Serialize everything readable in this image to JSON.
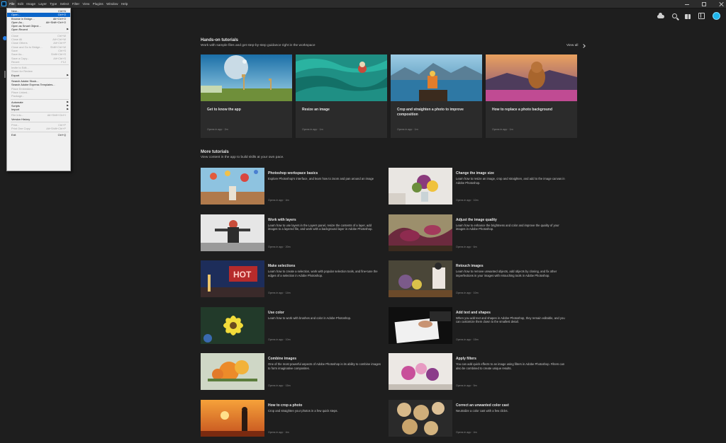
{
  "menubar": {
    "items": [
      "File",
      "Edit",
      "Image",
      "Layer",
      "Type",
      "Select",
      "Filter",
      "View",
      "Plugins",
      "Window",
      "Help"
    ]
  },
  "file_menu": {
    "items": [
      {
        "label": "New...",
        "shortcut": "Ctrl+N",
        "state": "normal"
      },
      {
        "label": "Open...",
        "shortcut": "Ctrl+O",
        "state": "highlight"
      },
      {
        "label": "Browse in Bridge...",
        "shortcut": "Alt+Ctrl+O",
        "state": "normal"
      },
      {
        "label": "Open As...",
        "shortcut": "Alt+Shift+Ctrl+O",
        "state": "normal"
      },
      {
        "label": "Open as Smart Object...",
        "shortcut": "",
        "state": "normal"
      },
      {
        "label": "Open Recent",
        "shortcut": "",
        "state": "normal",
        "submenu": true,
        "sep_after": true
      },
      {
        "label": "Close",
        "shortcut": "Ctrl+W",
        "state": "disabled"
      },
      {
        "label": "Close All",
        "shortcut": "Alt+Ctrl+W",
        "state": "disabled"
      },
      {
        "label": "Close Others",
        "shortcut": "Alt+Ctrl+P",
        "state": "disabled"
      },
      {
        "label": "Close and Go to Bridge...",
        "shortcut": "Shift+Ctrl+W",
        "state": "disabled"
      },
      {
        "label": "Save",
        "shortcut": "Ctrl+S",
        "state": "disabled"
      },
      {
        "label": "Save As...",
        "shortcut": "Shift+Ctrl+S",
        "state": "disabled"
      },
      {
        "label": "Save a Copy...",
        "shortcut": "Alt+Ctrl+S",
        "state": "disabled"
      },
      {
        "label": "Revert",
        "shortcut": "F12",
        "state": "disabled",
        "sep_after": true
      },
      {
        "label": "Invite to Edit...",
        "shortcut": "",
        "state": "disabled"
      },
      {
        "label": "Share for Review",
        "shortcut": "",
        "state": "disabled"
      },
      {
        "label": "Export",
        "shortcut": "",
        "state": "normal",
        "submenu": true,
        "sep_after": true
      },
      {
        "label": "Search Adobe Stock...",
        "shortcut": "",
        "state": "normal"
      },
      {
        "label": "Search Adobe Express Templates...",
        "shortcut": "",
        "state": "normal"
      },
      {
        "label": "Place Embedded...",
        "shortcut": "",
        "state": "disabled"
      },
      {
        "label": "Place Linked...",
        "shortcut": "",
        "state": "disabled"
      },
      {
        "label": "Package...",
        "shortcut": "",
        "state": "disabled",
        "sep_after": true
      },
      {
        "label": "Automate",
        "shortcut": "",
        "state": "normal",
        "submenu": true
      },
      {
        "label": "Scripts",
        "shortcut": "",
        "state": "normal",
        "submenu": true
      },
      {
        "label": "Import",
        "shortcut": "",
        "state": "normal",
        "submenu": true,
        "sep_after": true
      },
      {
        "label": "File Info...",
        "shortcut": "Alt+Shift+Ctrl+I",
        "state": "disabled"
      },
      {
        "label": "Version History",
        "shortcut": "",
        "state": "normal",
        "sep_after": true
      },
      {
        "label": "Print...",
        "shortcut": "Ctrl+P",
        "state": "disabled"
      },
      {
        "label": "Print One Copy",
        "shortcut": "Alt+Shift+Ctrl+P",
        "state": "disabled",
        "sep_after": true
      },
      {
        "label": "Exit",
        "shortcut": "Ctrl+Q",
        "state": "normal"
      }
    ]
  },
  "hands_on": {
    "title": "Hands-on tutorials",
    "subtitle": "Work with sample files and get step-by-step guidance right in the workspace",
    "view_all": "View all",
    "cards": [
      {
        "title": "Get to know the app",
        "meta": "Opens in app  ·  2m",
        "thumb": "thumb-planet"
      },
      {
        "title": "Resize an image",
        "meta": "Opens in app  ·  1m",
        "thumb": "thumb-fabric"
      },
      {
        "title": "Crop and straighten a photo to improve composition",
        "meta": "Opens in app  ·  1m",
        "thumb": "thumb-lake"
      },
      {
        "title": "How to replace a photo background",
        "meta": "Opens in app  ·  1m",
        "thumb": "thumb-dog"
      }
    ]
  },
  "more": {
    "title": "More tutorials",
    "subtitle": "View content in the app to build skills at your own pace.",
    "items": [
      {
        "title": "Photoshop workspace basics",
        "desc": "Explore Photoshop's interface, and learn how to zoom and pan around an image",
        "meta": "Opens in app  ·  4m",
        "thumb": "balloons"
      },
      {
        "title": "Change the image size",
        "desc": "Learn how to resize an image, crop and straighten, and add to the image canvas in Adobe Photoshop.",
        "meta": "Opens in app  ·  10m",
        "thumb": "flowers-vase"
      },
      {
        "title": "Work with layers",
        "desc": "Learn how to use layers in the Layers panel, resize the contents of a layer, add images to a layered file, and work with a background layer in Adobe Photoshop.",
        "meta": "Opens in app  ·  20m",
        "thumb": "studio"
      },
      {
        "title": "Adjust the image quality",
        "desc": "Learn how to enhance the brightness and color and improve the quality of your images in Adobe Photoshop.",
        "meta": "Opens in app  ·  6m",
        "thumb": "callas"
      },
      {
        "title": "Make selections",
        "desc": "Learn how to create a selection, work with popular selection tools, and fine-tune the edges of a selection in Adobe Photoshop.",
        "meta": "Opens in app  ·  14m",
        "thumb": "hotel"
      },
      {
        "title": "Retouch images",
        "desc": "Learn how to remove unwanted objects, add objects by cloning, and fix other imperfections in your images with retouching tools in Adobe Photoshop.",
        "meta": "Opens in app  ·  10m",
        "thumb": "florist"
      },
      {
        "title": "Use color",
        "desc": "Learn how to work with brushes and color in Adobe Photoshop.",
        "meta": "Opens in app  ·  10m",
        "thumb": "yellow-flower"
      },
      {
        "title": "Add text and shapes",
        "desc": "When you add text and shapes in Adobe Photoshop, they remain editable, and you can customize them down to the smallest detail.",
        "meta": "Opens in app  ·  15m",
        "thumb": "hands-paper"
      },
      {
        "title": "Combine images",
        "desc": "One of the most powerful aspects of Adobe Photoshop is its ability to combine images to form imaginative composites.",
        "meta": "Opens in app  ·  15m",
        "thumb": "orange-flowers"
      },
      {
        "title": "Apply filters",
        "desc": "You can add quick effects to an image using filters in Adobe Photoshop. Filters can also be combined to create unique results.",
        "meta": "Opens in app  ·  5m",
        "thumb": "pink-flowers"
      },
      {
        "title": "How to crop a photo",
        "desc": "Crop and straighten your photos in a few quick steps.",
        "meta": "Opens in app  ·  4m",
        "thumb": "sunset"
      },
      {
        "title": "Correct an unwanted color cast",
        "desc": "Neutralize a color cast with a few clicks.",
        "meta": "Opens in app  ·  4m",
        "thumb": "cookies"
      }
    ]
  },
  "colors": {
    "background": "#1e1e1e",
    "card": "#2b2b2b",
    "accent": "#1fb6ec",
    "menu_highlight": "#0a64c8"
  },
  "icons": [
    "cloud-icon",
    "search-icon",
    "gift-icon",
    "sidebar-icon",
    "avatar",
    "chevron-right-icon"
  ]
}
